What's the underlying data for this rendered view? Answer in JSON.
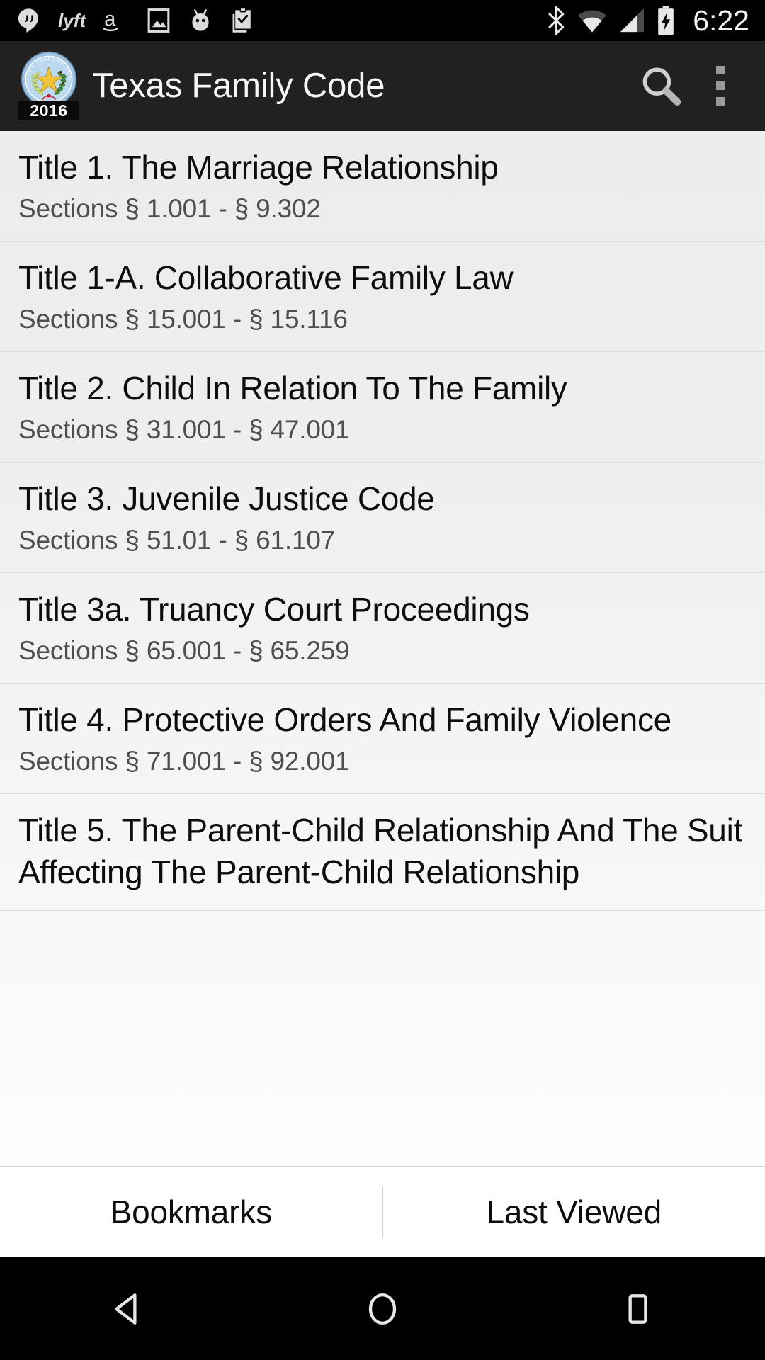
{
  "status_bar": {
    "time": "6:22",
    "left_icons": [
      {
        "name": "hangouts-icon"
      },
      {
        "name": "lyft-icon"
      },
      {
        "name": "amazon-icon"
      },
      {
        "name": "photos-icon"
      },
      {
        "name": "cyanogenmod-icon"
      },
      {
        "name": "clipboard-check-icon"
      }
    ],
    "right_icons": [
      {
        "name": "bluetooth-icon"
      },
      {
        "name": "wifi-icon"
      },
      {
        "name": "cellular-signal-icon"
      },
      {
        "name": "battery-charging-icon"
      }
    ]
  },
  "app_bar": {
    "title": "Texas Family Code",
    "icon_name": "texas-state-seal-icon",
    "icon_year": "2016",
    "search_label": "search-icon",
    "overflow_label": "overflow-menu-icon",
    "background": "#212121"
  },
  "list": {
    "items": [
      {
        "title": "Title 1. The Marriage Relationship",
        "sections": "Sections § 1.001  - § 9.302"
      },
      {
        "title": "Title 1-A. Collaborative Family Law",
        "sections": "Sections § 15.001  - § 15.116"
      },
      {
        "title": "Title 2. Child In Relation To The Family",
        "sections": "Sections § 31.001  - § 47.001"
      },
      {
        "title": "Title 3. Juvenile Justice Code",
        "sections": "Sections § 51.01  - § 61.107"
      },
      {
        "title": "Title 3a. Truancy Court Proceedings",
        "sections": "Sections § 65.001  - § 65.259"
      },
      {
        "title": "Title 4. Protective Orders And Family Violence",
        "sections": "Sections § 71.001  - § 92.001"
      },
      {
        "title": "Title 5. The Parent-Child Relationship And The Suit Affecting The Parent-Child Relationship",
        "sections": ""
      }
    ]
  },
  "bottom_bar": {
    "bookmarks_label": "Bookmarks",
    "last_viewed_label": "Last Viewed"
  },
  "nav_bar": {
    "back_label": "back-button",
    "home_label": "home-button",
    "recents_label": "recents-button"
  }
}
